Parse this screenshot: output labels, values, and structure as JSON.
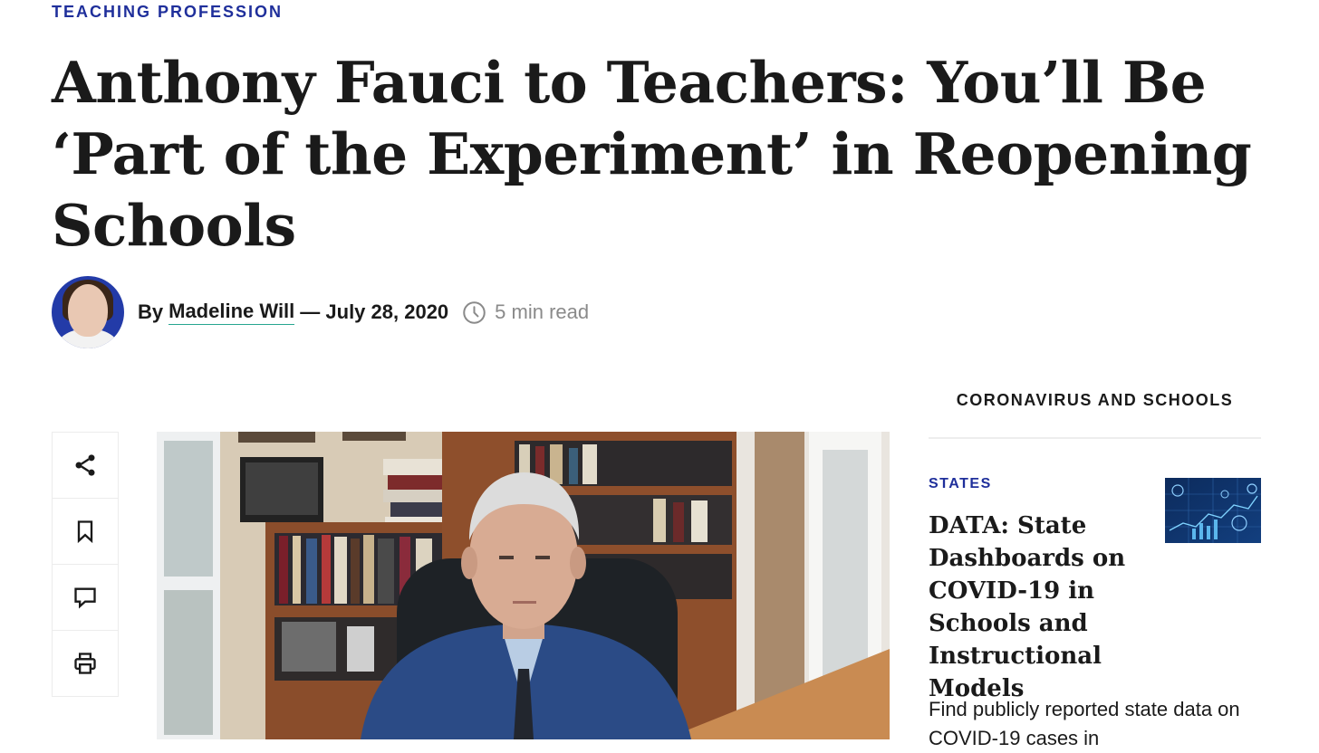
{
  "article": {
    "kicker": "TEACHING PROFESSION",
    "title": "Anthony Fauci to Teachers: You’ll Be ‘Part of the Experiment’ in Reopening Schools",
    "byline_prefix": "By",
    "author": "Madeline Will",
    "date": "— July 28, 2020",
    "read_time": "5 min read"
  },
  "share_rail": {
    "items": [
      {
        "icon": "share-icon"
      },
      {
        "icon": "bookmark-icon"
      },
      {
        "icon": "comment-icon"
      },
      {
        "icon": "print-icon"
      }
    ]
  },
  "sidebar": {
    "heading": "CORONAVIRUS AND SCHOOLS",
    "card": {
      "tag": "STATES",
      "title": "DATA: State Dashboards on COVID-19 in Schools and Instructional Models",
      "description": "Find publicly reported state data on COVID-19 cases in"
    }
  },
  "colors": {
    "accent": "#1f2f9b",
    "author_underline": "#27a68f",
    "text": "#1a1a1a",
    "muted": "#8a8a8a"
  }
}
